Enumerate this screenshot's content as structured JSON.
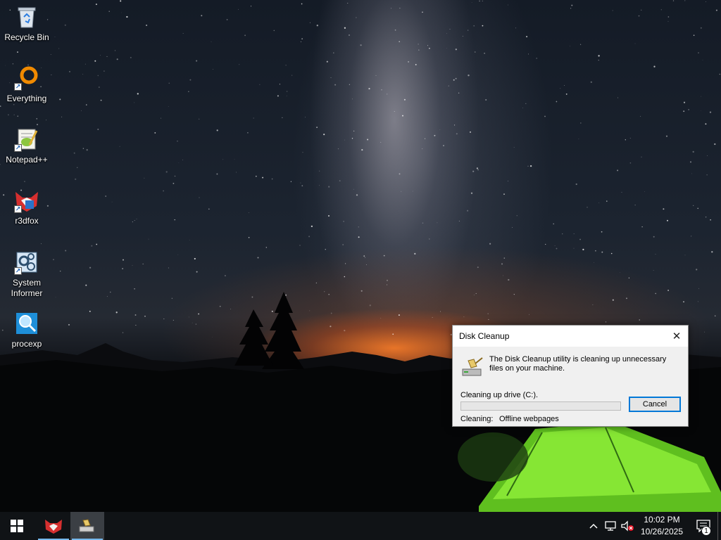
{
  "desktop": {
    "icons": [
      {
        "label": "Recycle Bin",
        "icon": "recycle-bin-icon"
      },
      {
        "label": "Everything",
        "icon": "everything-icon"
      },
      {
        "label": "Notepad++",
        "icon": "notepad-plus-plus-icon"
      },
      {
        "label": "r3dfox",
        "icon": "r3dfox-icon"
      },
      {
        "label": "System Informer",
        "icon": "system-informer-icon"
      },
      {
        "label": "procexp",
        "icon": "procexp-icon"
      }
    ]
  },
  "dialog": {
    "title": "Disk Cleanup",
    "close_glyph": "✕",
    "message": "The Disk Cleanup utility is cleaning up unnecessary files on your machine.",
    "drive_text": "Cleaning up drive  (C:).",
    "progress_fraction": 0.0,
    "cancel_label": "Cancel",
    "cleaning_label": "Cleaning:",
    "cleaning_value": "Offline webpages"
  },
  "taskbar": {
    "start_icon": "windows-logo-icon",
    "apps": [
      {
        "icon": "r3dfox-icon",
        "running": true,
        "active": false
      },
      {
        "icon": "disk-cleanup-icon",
        "running": true,
        "active": true
      }
    ],
    "tray": {
      "chevron": "^",
      "time": "10:02 PM",
      "date": "10/26/2025",
      "notification_count": "1"
    }
  },
  "colors": {
    "accent": "#0078d7",
    "taskbar_bg": "#101316",
    "tent_green": "#7fe22b"
  }
}
